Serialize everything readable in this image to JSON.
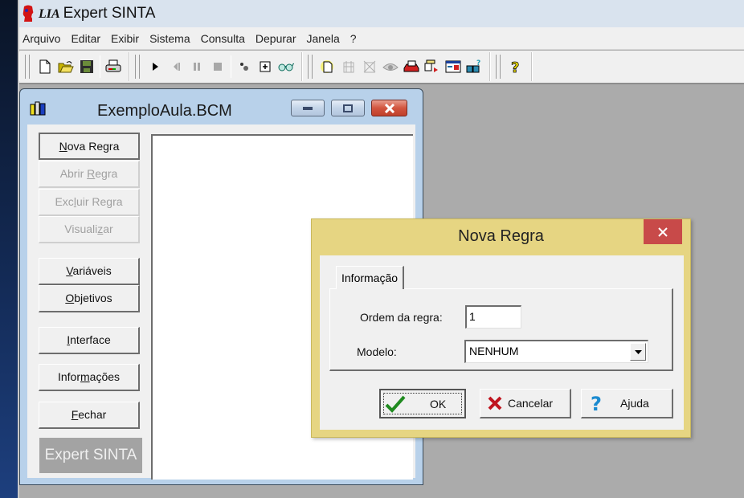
{
  "app": {
    "title_prefix": "LIA",
    "title": "Expert SINTA",
    "menu": [
      "Arquivo",
      "Editar",
      "Exibir",
      "Sistema",
      "Consulta",
      "Depurar",
      "Janela",
      "?"
    ],
    "toolbar": {
      "group1": [
        "new-file-icon",
        "open-folder-icon",
        "save-disk-icon",
        "print-icon"
      ],
      "group2": [
        "play-icon",
        "step-back-icon",
        "pause-icon",
        "stop-icon",
        "dots-icon",
        "plus-box-icon",
        "glasses-icon"
      ],
      "group3": [
        "new-rule-icon",
        "tool-a-icon",
        "tool-b-icon",
        "eye-icon",
        "printer-red-icon",
        "form-arrow-icon",
        "window-chart-icon",
        "book-help-icon"
      ],
      "group4": [
        "help-question-icon"
      ]
    }
  },
  "child_window": {
    "title": "ExemploAula.BCM",
    "buttons": [
      {
        "label": "Nova Regra",
        "accel": "N",
        "enabled": true
      },
      {
        "label": "Abrir Regra",
        "accel": "R",
        "enabled": false
      },
      {
        "label": "Excluir Regra",
        "accel": "l",
        "enabled": false
      },
      {
        "label": "Visualizar",
        "accel": "z",
        "enabled": false
      },
      {
        "label": "Variáveis",
        "accel": "V",
        "enabled": true
      },
      {
        "label": "Objetivos",
        "accel": "O",
        "enabled": true
      },
      {
        "label": "Interface",
        "accel": "I",
        "enabled": true
      },
      {
        "label": "Informações",
        "accel": "m",
        "enabled": true
      },
      {
        "label": "Fechar",
        "accel": "F",
        "enabled": true
      }
    ],
    "brand": "Expert SINTA"
  },
  "dialog": {
    "title": "Nova Regra",
    "tab": "Informação",
    "order_label": "Ordem da regra:",
    "order_value": "1",
    "model_label": "Modelo:",
    "model_value": "NENHUM",
    "ok_label": "OK",
    "cancel_label": "Cancelar",
    "help_label": "Ajuda"
  }
}
